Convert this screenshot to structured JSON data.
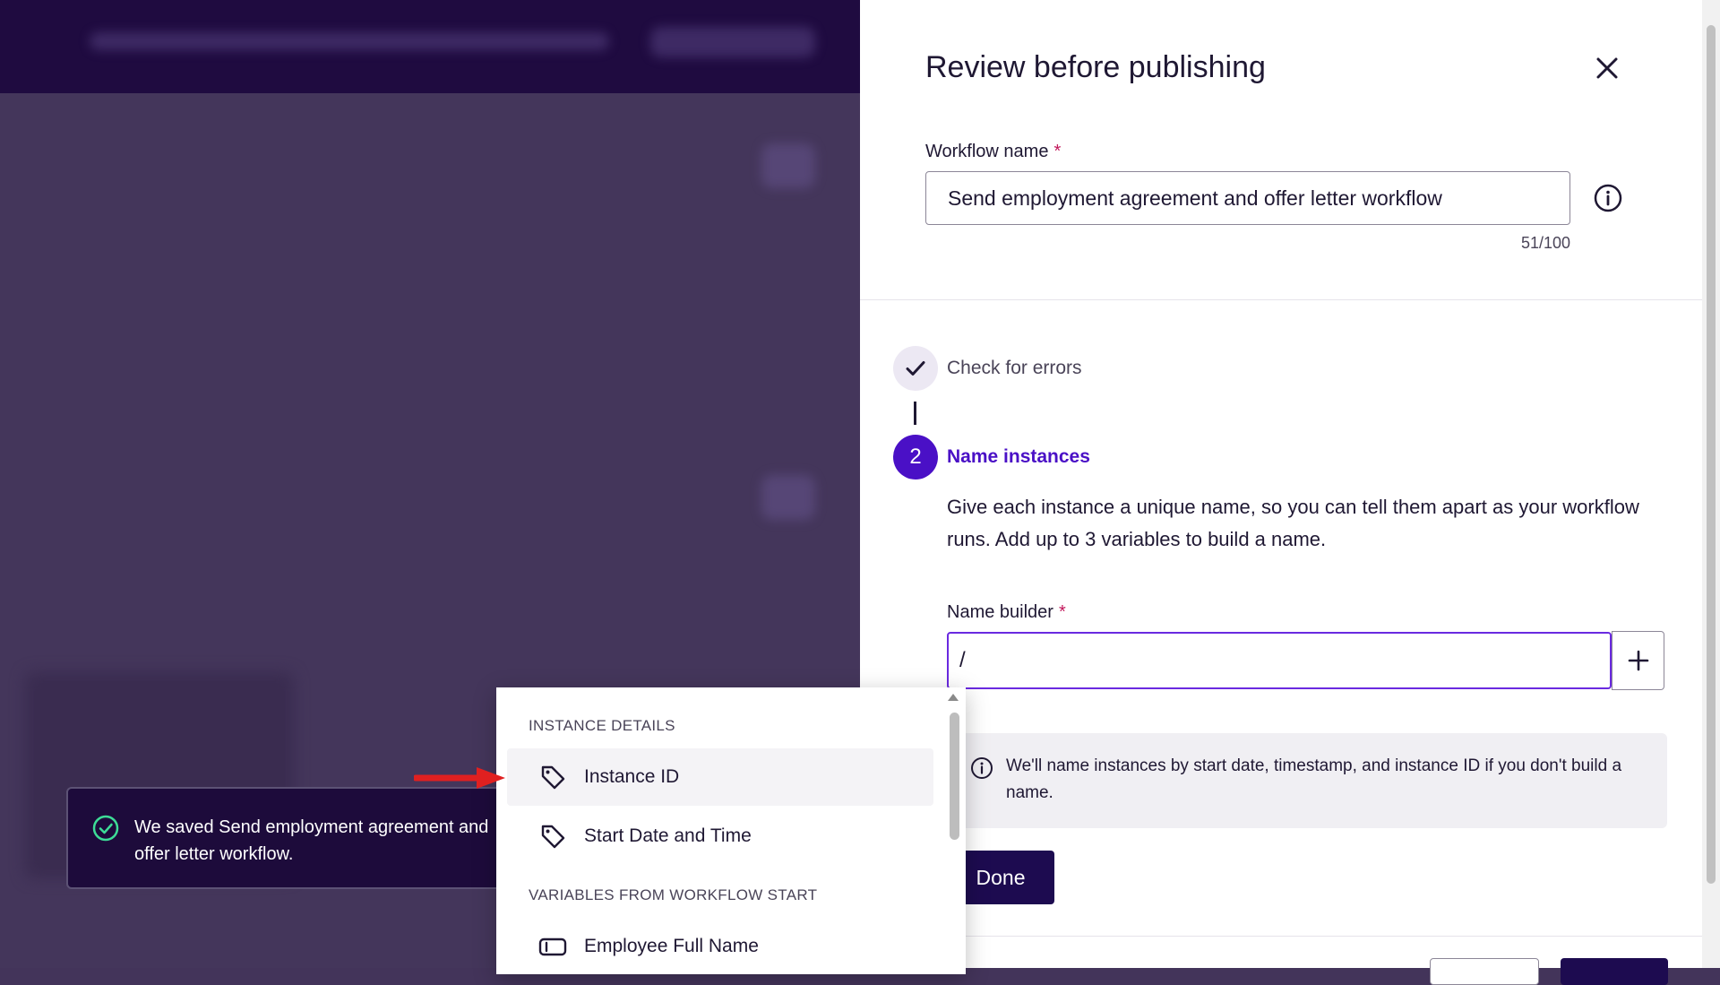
{
  "drawer": {
    "title": "Review before publishing",
    "workflow_name": {
      "label": "Workflow name",
      "required_mark": "*",
      "value": "Send employment agreement and offer letter workflow",
      "char_count": "51/100"
    },
    "steps": [
      {
        "label": "Check for errors",
        "state": "done"
      },
      {
        "number": "2",
        "label": "Name instances",
        "state": "active"
      }
    ],
    "description": "Give each instance a unique name, so you can tell them apart as your workflow runs. Add up to 3 variables to build a name.",
    "name_builder": {
      "label": "Name builder",
      "required_mark": "*",
      "value": "/"
    },
    "info_text": "We'll name instances by start date, timestamp, and instance ID if you don't build a name.",
    "done_label": "Done"
  },
  "dropdown": {
    "sections": [
      {
        "header": "INSTANCE DETAILS",
        "items": [
          {
            "label": "Instance ID",
            "icon": "tag-icon"
          },
          {
            "label": "Start Date and Time",
            "icon": "tag-icon"
          }
        ]
      },
      {
        "header": "VARIABLES FROM WORKFLOW START",
        "items": [
          {
            "label": "Employee Full Name",
            "icon": "text-field-icon"
          }
        ]
      }
    ]
  },
  "toast": {
    "message": "We saved Send employment agreement and offer letter workflow."
  },
  "colors": {
    "accent": "#4a10c6",
    "primary_button": "#1d0b50",
    "toast_bg": "#1d0b3b",
    "success": "#3ddc97",
    "annotation": "#e02020"
  }
}
